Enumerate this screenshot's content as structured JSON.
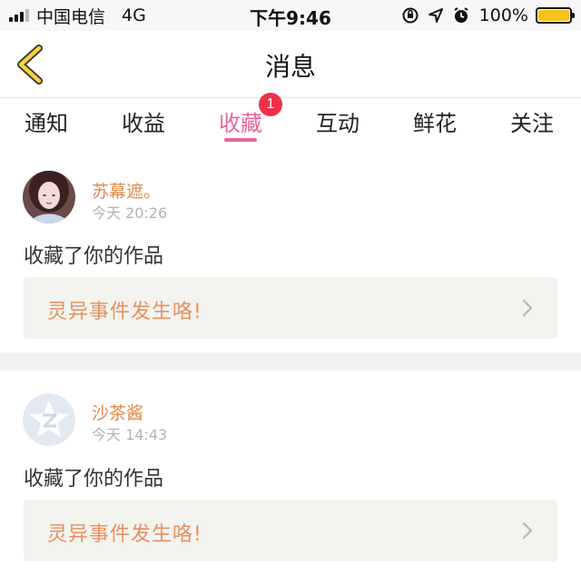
{
  "status_bar": {
    "carrier": "中国电信",
    "network": "4G",
    "time": "下午9:46",
    "battery_percent": "100%",
    "battery_color": "#f5c21a"
  },
  "header": {
    "title": "消息",
    "back_icon": "chevron-left-icon"
  },
  "tabs": [
    {
      "label": "通知"
    },
    {
      "label": "收益"
    },
    {
      "label": "收藏",
      "active": true,
      "badge": "1"
    },
    {
      "label": "互动"
    },
    {
      "label": "鲜花"
    },
    {
      "label": "关注"
    }
  ],
  "messages": [
    {
      "sender": "苏幕遮。",
      "time": "今天 20:26",
      "action": "收藏了你的作品",
      "work_title": "灵异事件发生咯!"
    },
    {
      "sender": "沙茶酱",
      "time": "今天 14:43",
      "action": "收藏了你的作品",
      "work_title": "灵异事件发生咯!"
    }
  ],
  "colors": {
    "accent": "#e4669b",
    "sender": "#e08a4f",
    "work_title": "#e69060",
    "badge": "#f0304a"
  }
}
